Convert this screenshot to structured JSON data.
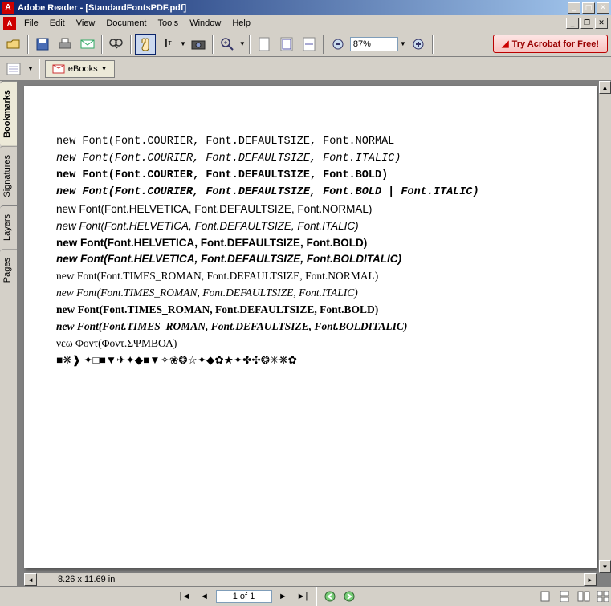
{
  "app": {
    "title": "Adobe Reader - [StandardFontsPDF.pdf]"
  },
  "menu": {
    "items": [
      "File",
      "Edit",
      "View",
      "Document",
      "Tools",
      "Window",
      "Help"
    ]
  },
  "toolbar": {
    "zoom": "87%",
    "try_label": "Try Acrobat for Free!",
    "ebooks_label": "eBooks"
  },
  "sidetabs": {
    "items": [
      "Bookmarks",
      "Signatures",
      "Layers",
      "Pages"
    ]
  },
  "doc": {
    "lines": [
      {
        "text": "new Font(Font.COURIER, Font.DEFAULTSIZE, Font.NORMAL",
        "cls": "courier"
      },
      {
        "text": "new Font(Font.COURIER, Font.DEFAULTSIZE, Font.ITALIC)",
        "cls": "courier italic"
      },
      {
        "text": "new Font(Font.COURIER, Font.DEFAULTSIZE, Font.BOLD)",
        "cls": "courier bold"
      },
      {
        "text": "new Font(Font.COURIER, Font.DEFAULTSIZE, Font.BOLD | Font.ITALIC)",
        "cls": "courier bold italic"
      },
      {
        "text": "new Font(Font.HELVETICA, Font.DEFAULTSIZE, Font.NORMAL)",
        "cls": "helv"
      },
      {
        "text": "new Font(Font.HELVETICA, Font.DEFAULTSIZE, Font.ITALIC)",
        "cls": "helv italic"
      },
      {
        "text": "new Font(Font.HELVETICA, Font.DEFAULTSIZE, Font.BOLD)",
        "cls": "helv bold"
      },
      {
        "text": "new Font(Font.HELVETICA, Font.DEFAULTSIZE, Font.BOLDITALIC)",
        "cls": "helv bold italic"
      },
      {
        "text": "new Font(Font.TIMES_ROMAN, Font.DEFAULTSIZE, Font.NORMAL)",
        "cls": "times"
      },
      {
        "text": "new Font(Font.TIMES_ROMAN, Font.DEFAULTSIZE, Font.ITALIC)",
        "cls": "times italic"
      },
      {
        "text": "new Font(Font.TIMES_ROMAN, Font.DEFAULTSIZE, Font.BOLD)",
        "cls": "times bold"
      },
      {
        "text": "new Font(Font.TIMES_ROMAN, Font.DEFAULTSIZE, Font.BOLDITALIC)",
        "cls": "times bold italic"
      },
      {
        "text": "νεω Φοντ(Φοντ.ΣΨΜΒΟΛ)",
        "cls": "symbol"
      },
      {
        "text": "■❋❱ ✦□■▼✈✦◆■▼✧❀❂☆✦◆✿★✦✤✣❂✳❋✿",
        "cls": "symbol"
      }
    ]
  },
  "status": {
    "size": "8.26 x 11.69 in",
    "page": "1 of 1"
  }
}
